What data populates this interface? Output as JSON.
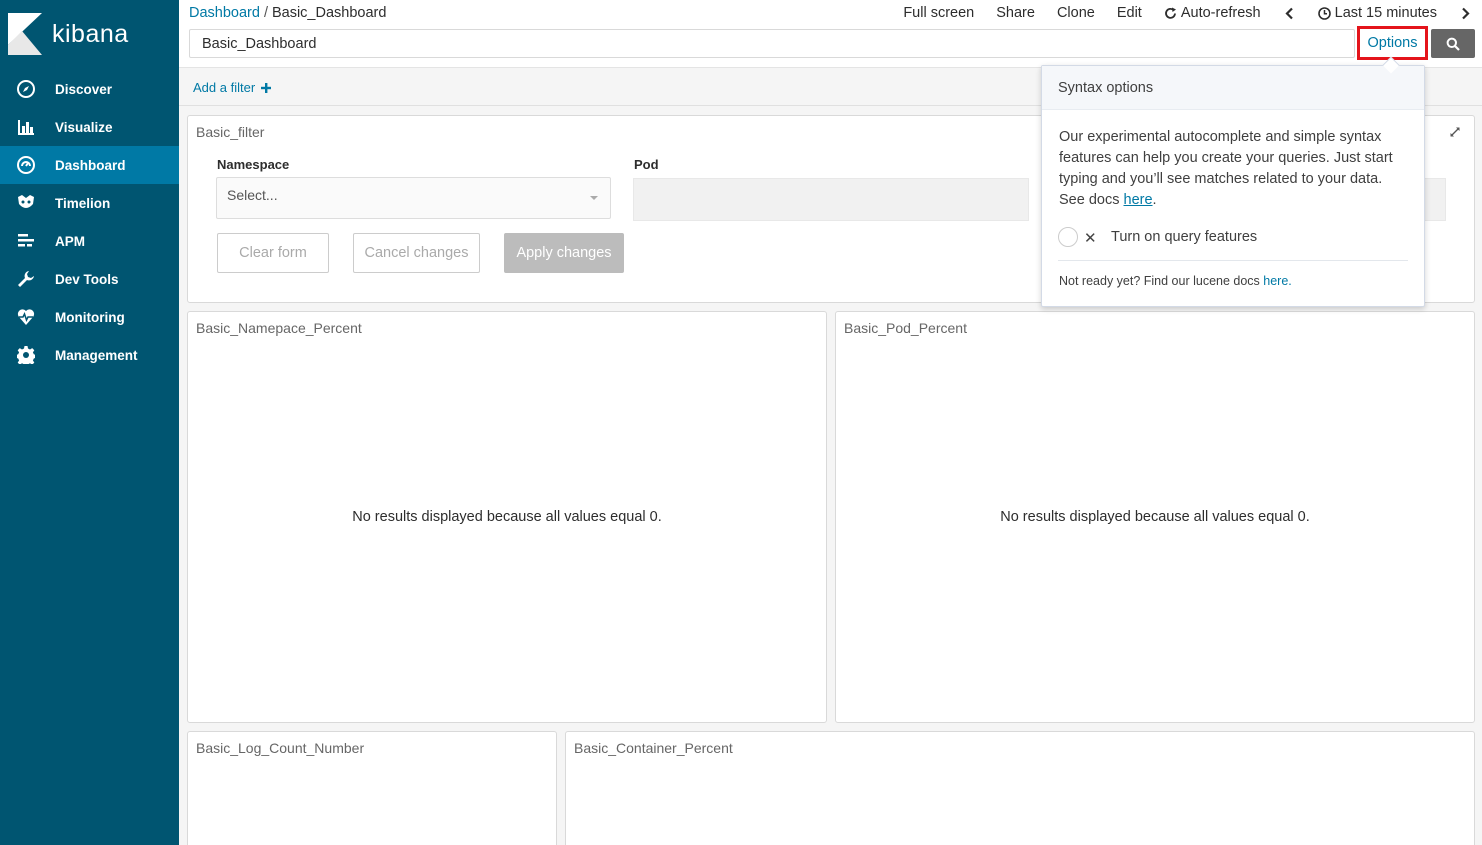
{
  "brand": {
    "name": "kibana"
  },
  "sidebar": {
    "items": [
      {
        "label": "Discover",
        "icon": "compass-icon",
        "active": false
      },
      {
        "label": "Visualize",
        "icon": "bar-chart-icon",
        "active": false
      },
      {
        "label": "Dashboard",
        "icon": "dashboard-icon",
        "active": true
      },
      {
        "label": "Timelion",
        "icon": "timelion-icon",
        "active": false
      },
      {
        "label": "APM",
        "icon": "apm-icon",
        "active": false
      },
      {
        "label": "Dev Tools",
        "icon": "wrench-icon",
        "active": false
      },
      {
        "label": "Monitoring",
        "icon": "heartbeat-icon",
        "active": false
      },
      {
        "label": "Management",
        "icon": "gear-icon",
        "active": false
      }
    ]
  },
  "breadcrumb": {
    "parent": "Dashboard",
    "separator": "/",
    "current": "Basic_Dashboard"
  },
  "top_menu": {
    "full_screen": "Full screen",
    "share": "Share",
    "clone": "Clone",
    "edit": "Edit",
    "auto_refresh": "Auto-refresh",
    "time_range": "Last 15 minutes"
  },
  "query": {
    "value": "Basic_Dashboard",
    "options_label": "Options"
  },
  "filter_bar": {
    "add_filter": "Add a filter"
  },
  "filter_panel": {
    "title": "Basic_filter",
    "namespace_label": "Namespace",
    "namespace_placeholder": "Select...",
    "pod_label": "Pod",
    "clear_form": "Clear form",
    "cancel_changes": "Cancel changes",
    "apply_changes": "Apply changes"
  },
  "panels": {
    "namespace": {
      "title": "Basic_Namepace_Percent",
      "message": "No results displayed because all values equal 0."
    },
    "pod": {
      "title": "Basic_Pod_Percent",
      "message": "No results displayed because all values equal 0."
    },
    "log_count": {
      "title": "Basic_Log_Count_Number"
    },
    "container": {
      "title": "Basic_Container_Percent"
    }
  },
  "syntax_popover": {
    "title": "Syntax options",
    "body": "Our experimental autocomplete and simple syntax features can help you create your queries. Just start typing and you’ll see matches related to your data. See docs ",
    "docs_link": "here",
    "body_end": ".",
    "toggle_label": "Turn on query features",
    "toggle_on": false,
    "footer": "Not ready yet? Find our lucene docs ",
    "footer_link": "here."
  },
  "colors": {
    "sidebar": "#005571",
    "active": "#0079a5",
    "link": "#0079a5",
    "highlight": "#e4141b"
  }
}
